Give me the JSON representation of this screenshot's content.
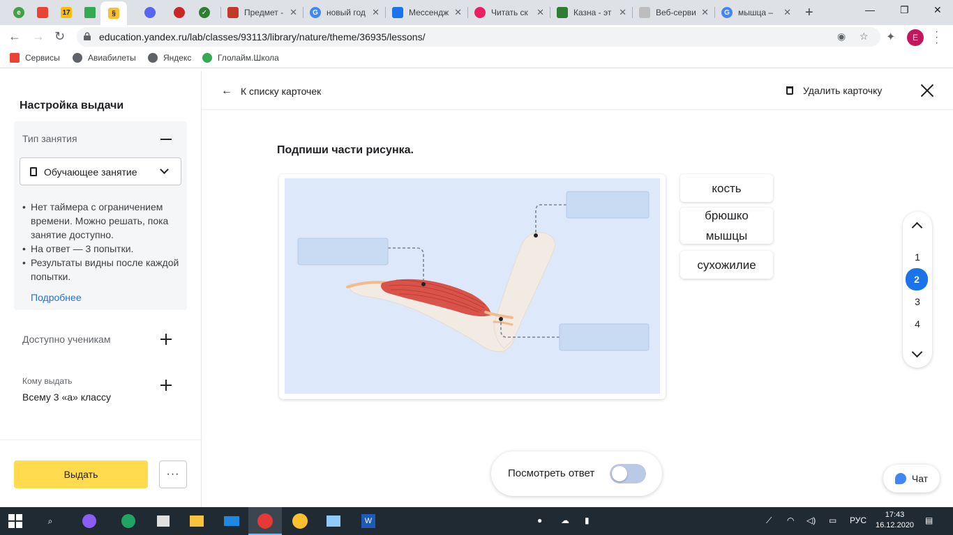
{
  "browser": {
    "tabs": [
      {
        "title": "Предмет -",
        "color": "#c0392b"
      },
      {
        "title": "новый год",
        "color": "#4285f4"
      },
      {
        "title": "Мессендж",
        "color": "#1a73e8"
      },
      {
        "title": "Читать ск",
        "color": "#e91e63"
      },
      {
        "title": "Казна - эт",
        "color": "#2e7d32"
      },
      {
        "title": "Веб-серви",
        "color": "#9e9e9e"
      },
      {
        "title": "мышца –",
        "color": "#4285f4"
      }
    ],
    "url": "education.yandex.ru/lab/classes/93113/library/nature/theme/36935/lessons/",
    "profile_initial": "E",
    "bookmarks": [
      {
        "label": "Сервисы",
        "color": "#ea4335"
      },
      {
        "label": "Авиабилеты",
        "color": "#5f6368"
      },
      {
        "label": "Яндекс",
        "color": "#5f6368"
      },
      {
        "label": "Глолайм.Школа",
        "color": "#34a853"
      }
    ]
  },
  "sidebar": {
    "title": "Настройка выдачи",
    "type_label": "Тип занятия",
    "type_value": "Обучающее занятие",
    "bullets": [
      "Нет таймера с ограничением времени. Можно решать, пока занятие доступно.",
      "На ответ — 3 попытки.",
      "Результаты видны после каждой попытки."
    ],
    "more_link": "Подробнее",
    "available_label": "Доступно ученикам",
    "issue_to_label": "Кому выдать",
    "issue_to_value": "Всему 3 «а» классу",
    "issue_button": "Выдать",
    "more_button": "···"
  },
  "main": {
    "back_link": "К списку карточек",
    "delete_link": "Удалить карточку",
    "task_title": "Подпиши части рисунка.",
    "word_cards": [
      "кость",
      "брюшко мышцы",
      "сухожилие"
    ],
    "pages": [
      "1",
      "2",
      "3",
      "4"
    ],
    "current_page": "2",
    "show_answer_label": "Посмотреть ответ",
    "show_answer_on": false,
    "chat_label": "Чат"
  },
  "colors": {
    "accent": "#1a73e8",
    "issue_button": "#ffdb4d",
    "diagram_bg": "#dde8fa",
    "label_slot": "#c9daf3",
    "muscle": "#d9534a",
    "bone": "#f2ebe4",
    "tendon": "#f5b98a"
  },
  "taskbar": {
    "lang": "РУС",
    "time": "17:43",
    "date": "16.12.2020"
  }
}
